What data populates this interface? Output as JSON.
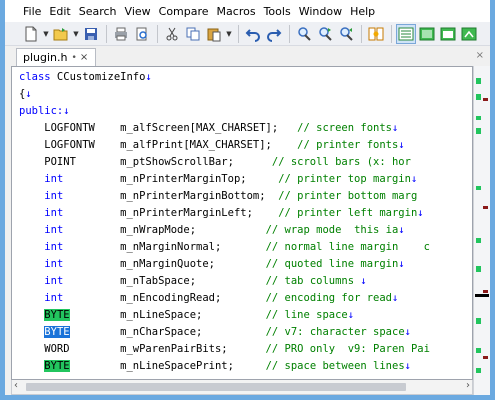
{
  "menu": {
    "items": [
      "File",
      "Edit",
      "Search",
      "View",
      "Compare",
      "Macros",
      "Tools",
      "Window",
      "Help"
    ]
  },
  "toolbar": {
    "buttons": [
      {
        "icon": "new-file-icon"
      },
      {
        "icon": "open-folder-icon"
      },
      {
        "icon": "save-icon"
      },
      {
        "icon": "print-icon"
      },
      {
        "icon": "print-preview-icon"
      },
      {
        "icon": "cut-icon"
      },
      {
        "icon": "copy-icon"
      },
      {
        "icon": "paste-icon"
      },
      {
        "icon": "undo-icon"
      },
      {
        "icon": "redo-icon"
      },
      {
        "icon": "find-icon"
      },
      {
        "icon": "find-next-icon"
      },
      {
        "icon": "find-prev-icon"
      },
      {
        "icon": "compare-icon"
      },
      {
        "icon": "view-mode-icon"
      },
      {
        "icon": "green-panel-icon"
      },
      {
        "icon": "window-icon"
      },
      {
        "icon": "restore-icon"
      }
    ]
  },
  "tab": {
    "label": "plugin.h",
    "pin": "•",
    "close": "×"
  },
  "tabbar": {
    "close_all": "×"
  },
  "scroll": {
    "left_arrow": "‹",
    "right_arrow": "›"
  },
  "colors": {
    "keyword": "#0000ff",
    "comment": "#008000",
    "highlight_green": "#22c55e",
    "highlight_blue": "#1a73d9",
    "gutter_green": "#22c55e",
    "gutter_yellow": "#f5c518"
  },
  "code": {
    "lines": [
      {
        "gutter": "",
        "parts": [
          {
            "t": "class",
            "c": "kw"
          },
          {
            "t": " CCustomizeInfo"
          },
          {
            "t": "↓",
            "c": "kw"
          }
        ]
      },
      {
        "gutter": "",
        "parts": [
          {
            "t": "{"
          },
          {
            "t": "↓",
            "c": "kw"
          }
        ]
      },
      {
        "gutter": "",
        "parts": [
          {
            "t": "public:",
            "c": "kw"
          },
          {
            "t": "↓",
            "c": "kw"
          }
        ]
      },
      {
        "gutter": "yellow",
        "parts": [
          {
            "t": "    LOGFONTW    m_alfScreen[MAX_CHARSET];   "
          },
          {
            "t": "// screen fonts",
            "c": "cm"
          },
          {
            "t": "↓",
            "c": "kw"
          }
        ]
      },
      {
        "gutter": "yellow",
        "parts": [
          {
            "t": "    LOGFONTW    m_alfPrint[MAX_CHARSET];    "
          },
          {
            "t": "// printer fonts",
            "c": "cm"
          },
          {
            "t": "↓",
            "c": "kw"
          }
        ]
      },
      {
        "gutter": "",
        "parts": [
          {
            "t": "    POINT       m_ptShowScrollBar;      "
          },
          {
            "t": "// scroll bars (x: hor",
            "c": "cm"
          }
        ]
      },
      {
        "gutter": "",
        "parts": [
          {
            "t": "    "
          },
          {
            "t": "int",
            "c": "kw"
          },
          {
            "t": "         m_nPrinterMarginTop;     "
          },
          {
            "t": "// printer top margin",
            "c": "cm"
          },
          {
            "t": "↓",
            "c": "kw"
          }
        ]
      },
      {
        "gutter": "",
        "parts": [
          {
            "t": "    "
          },
          {
            "t": "int",
            "c": "kw"
          },
          {
            "t": "         m_nPrinterMarginBottom;  "
          },
          {
            "t": "// printer bottom marg",
            "c": "cm"
          }
        ]
      },
      {
        "gutter": "",
        "parts": [
          {
            "t": "    "
          },
          {
            "t": "int",
            "c": "kw"
          },
          {
            "t": "         m_nPrinterMarginLeft;    "
          },
          {
            "t": "// printer left margin",
            "c": "cm"
          },
          {
            "t": "↓",
            "c": "kw"
          }
        ]
      },
      {
        "gutter": "",
        "parts": [
          {
            "t": "    "
          },
          {
            "t": "int",
            "c": "kw"
          },
          {
            "t": "         m_nWrapMode;           "
          },
          {
            "t": "// wrap mode  this ia",
            "c": "cm"
          },
          {
            "t": "↓",
            "c": "kw"
          }
        ]
      },
      {
        "gutter": "green",
        "parts": [
          {
            "t": "    "
          },
          {
            "t": "int",
            "c": "kw"
          },
          {
            "t": "         m_nMarginNormal;       "
          },
          {
            "t": "// normal line margin    c",
            "c": "cm"
          }
        ]
      },
      {
        "gutter": "green",
        "parts": [
          {
            "t": "    "
          },
          {
            "t": "int",
            "c": "kw"
          },
          {
            "t": "         m_nMarginQuote;        "
          },
          {
            "t": "// quoted line margin",
            "c": "cm"
          },
          {
            "t": "↓",
            "c": "kw"
          }
        ]
      },
      {
        "gutter": "green",
        "parts": [
          {
            "t": "    "
          },
          {
            "t": "int",
            "c": "kw"
          },
          {
            "t": "         m_nTabSpace;           "
          },
          {
            "t": "// tab columns ",
            "c": "cm"
          },
          {
            "t": "↓",
            "c": "kw"
          }
        ]
      },
      {
        "gutter": "green",
        "parts": [
          {
            "t": "    "
          },
          {
            "t": "int",
            "c": "kw"
          },
          {
            "t": "         m_nEncodingRead;       "
          },
          {
            "t": "// encoding for read",
            "c": "cm"
          },
          {
            "t": "↓",
            "c": "kw"
          }
        ]
      },
      {
        "gutter": "green",
        "parts": [
          {
            "t": "    "
          },
          {
            "t": "BYTE",
            "c": "hl-green"
          },
          {
            "t": "        m_nLineSpace;          "
          },
          {
            "t": "// line space",
            "c": "cm"
          },
          {
            "t": "↓",
            "c": "kw"
          }
        ]
      },
      {
        "gutter": "green",
        "parts": [
          {
            "t": "    "
          },
          {
            "t": "BYTE",
            "c": "hl-blue"
          },
          {
            "t": "        m_nCharSpace;          "
          },
          {
            "t": "// v7: character space",
            "c": "cm"
          },
          {
            "t": "↓",
            "c": "kw"
          }
        ]
      },
      {
        "gutter": "green",
        "parts": [
          {
            "t": "    WORD        m_wParenPairBits;      "
          },
          {
            "t": "// PRO only  v9: Paren Pai",
            "c": "cm"
          }
        ]
      },
      {
        "gutter": "green",
        "parts": [
          {
            "t": "    "
          },
          {
            "t": "BYTE",
            "c": "hl-green"
          },
          {
            "t": "        m_nLineSpacePrint;     "
          },
          {
            "t": "// space between lines",
            "c": "cm"
          },
          {
            "t": "↓",
            "c": "kw"
          }
        ]
      }
    ]
  }
}
